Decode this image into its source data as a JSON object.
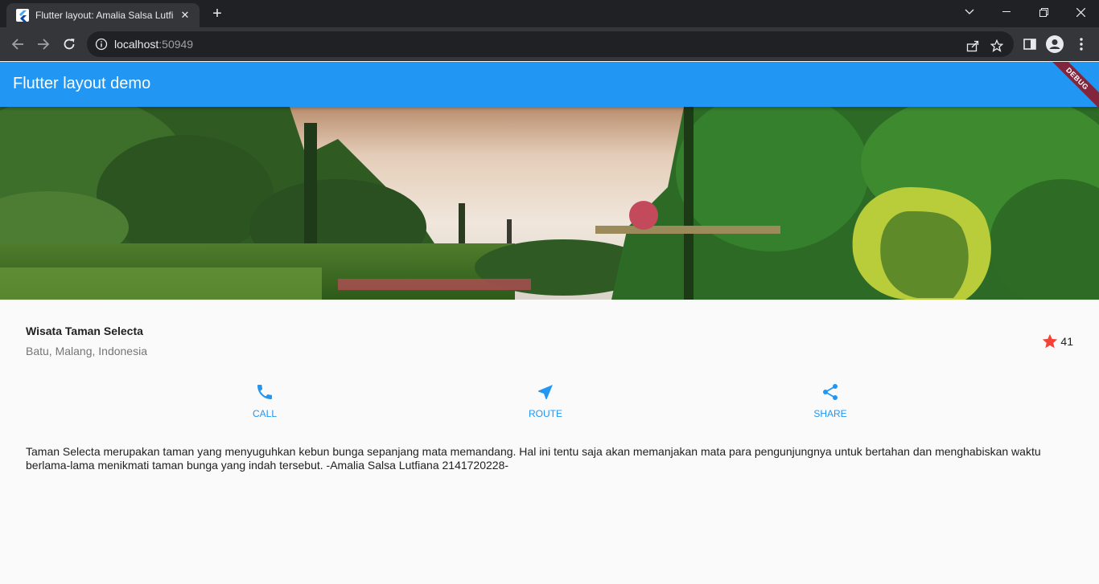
{
  "browser": {
    "tab_title": "Flutter layout: Amalia Salsa Lutfiana",
    "tab_close": "✕",
    "new_tab": "+",
    "url_host": "localhost",
    "url_port": ":50949"
  },
  "app": {
    "title": "Flutter layout demo",
    "debug_banner": "DEBUG",
    "primary_color": "#2196f3",
    "star_color": "#f44336"
  },
  "place": {
    "name": "Wisata Taman Selecta",
    "location": "Batu, Malang, Indonesia",
    "rating_count": "41"
  },
  "actions": [
    {
      "label": "CALL",
      "icon": "phone-icon"
    },
    {
      "label": "ROUTE",
      "icon": "near-me-icon"
    },
    {
      "label": "SHARE",
      "icon": "share-icon"
    }
  ],
  "description": "Taman Selecta merupakan taman yang menyuguhkan kebun bunga sepanjang mata memandang. Hal ini tentu saja akan memanjakan mata para pengunjungnya untuk bertahan dan menghabiskan waktu berlama-lama menikmati taman bunga yang indah tersebut.   -Amalia Salsa Lutfiana 2141720228-"
}
